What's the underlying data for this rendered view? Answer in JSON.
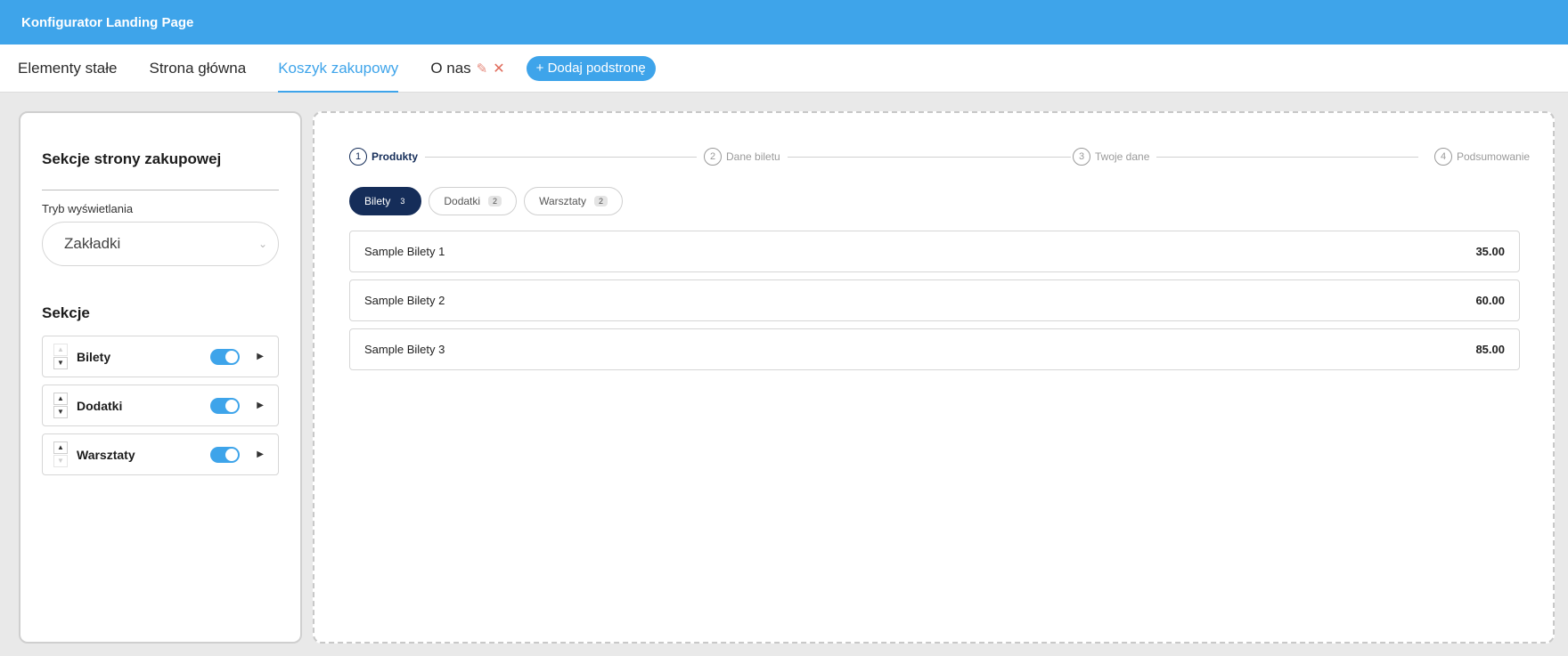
{
  "app": {
    "title": "Konfigurator Landing Page"
  },
  "nav": {
    "tabs": [
      {
        "label": "Elementy stałe"
      },
      {
        "label": "Strona główna"
      },
      {
        "label": "Koszyk zakupowy"
      },
      {
        "label": "O nas"
      }
    ],
    "active_tab": "Koszyk zakupowy",
    "edit_symbol": "✎",
    "delete_symbol": "✕",
    "add_page_label": "+ Dodaj podstronę"
  },
  "sidebar": {
    "title": "Sekcje strony zakupowej",
    "display_mode_label": "Tryb wyświetlania",
    "display_mode_value": "Zakładki",
    "sections_title": "Sekcje",
    "sections": [
      {
        "label": "Bilety",
        "enabled": true
      },
      {
        "label": "Dodatki",
        "enabled": true
      },
      {
        "label": "Warsztaty",
        "enabled": true
      }
    ]
  },
  "checkout": {
    "steps": [
      {
        "number": "1",
        "label": "Produkty",
        "active": true
      },
      {
        "number": "2",
        "label": "Dane biletu",
        "active": false
      },
      {
        "number": "3",
        "label": "Twoje dane",
        "active": false
      },
      {
        "number": "4",
        "label": "Podsumowanie",
        "active": false
      }
    ],
    "category_tabs": [
      {
        "label": "Bilety",
        "count": "3",
        "active": true
      },
      {
        "label": "Dodatki",
        "count": "2",
        "active": false
      },
      {
        "label": "Warsztaty",
        "count": "2",
        "active": false
      }
    ],
    "products": [
      {
        "name": "Sample Bilety 1",
        "price": "35.00"
      },
      {
        "name": "Sample Bilety 2",
        "price": "60.00"
      },
      {
        "name": "Sample Bilety 3",
        "price": "85.00"
      }
    ]
  },
  "colors": {
    "brand_blue": "#3ea4ea",
    "navy": "#152d59",
    "delete_red": "#e06b5b"
  }
}
